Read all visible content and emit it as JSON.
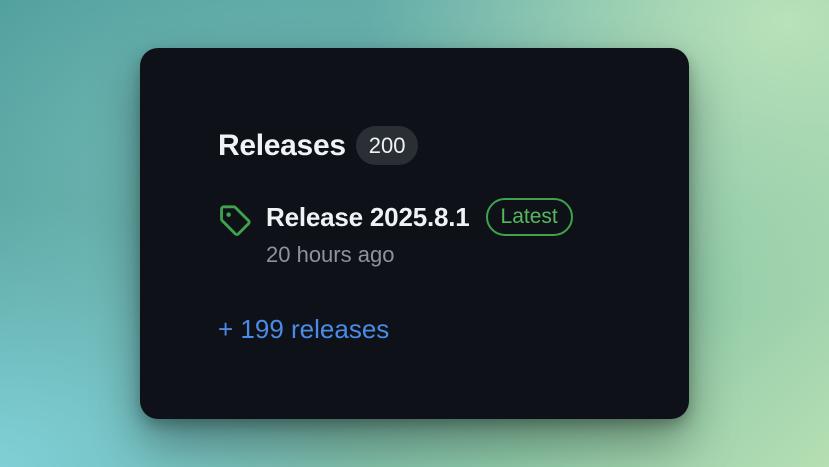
{
  "releases": {
    "title": "Releases",
    "count": "200",
    "latest": {
      "name": "Release 2025.8.1",
      "badge": "Latest",
      "time": "20 hours ago",
      "icon": "tag-icon"
    },
    "more_link": "+ 199 releases"
  },
  "colors": {
    "card_bg": "#0e1117",
    "text_primary": "#f0f3f6",
    "text_muted": "#8b949e",
    "accent_green": "#57b760",
    "link_blue": "#4b8ae6"
  }
}
